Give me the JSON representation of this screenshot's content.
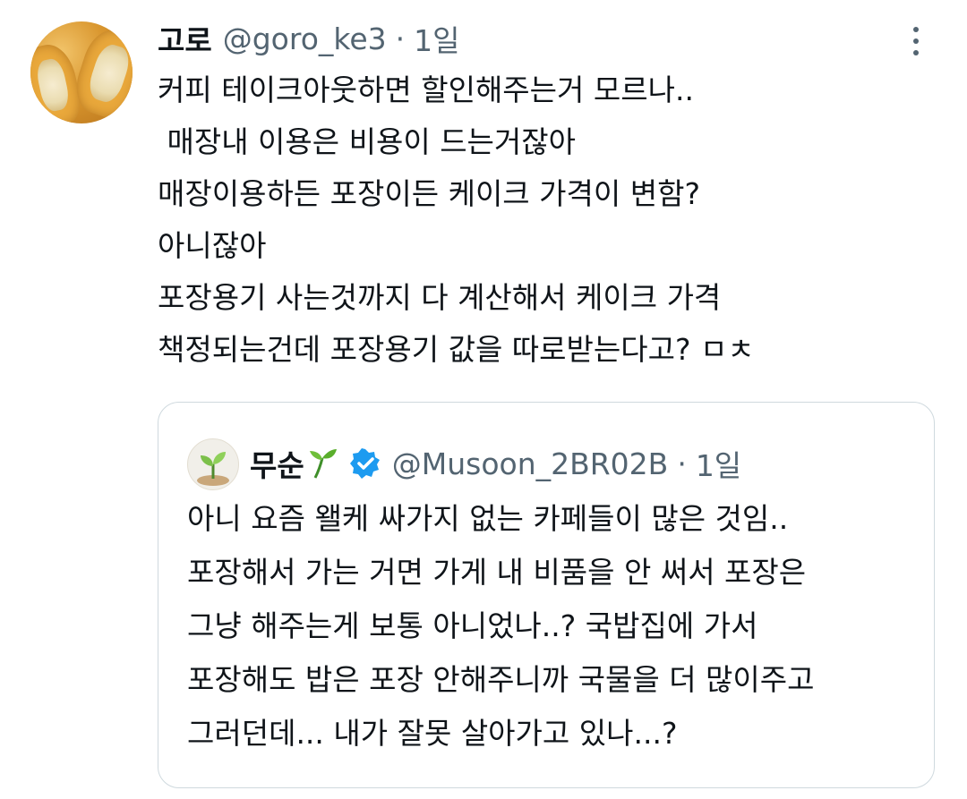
{
  "tweet": {
    "author": {
      "name": "고로",
      "handle": "@goro_ke3"
    },
    "separator": "·",
    "time": "1일",
    "more_icon": "more-vertical-icon",
    "lines": [
      "커피 테이크아웃하면 할인해주는거 모르나..",
      " 매장내 이용은 비용이 드는거잖아",
      "매장이용하든 포장이든 케이크 가격이 변함?",
      "아니잖아",
      "포장용기 사는것까지 다 계산해서 케이크 가격",
      "책정되는건데 포장용기 값을 따로받는다고? ㅁㅊ"
    ]
  },
  "quoted": {
    "author": {
      "name": "무순",
      "name_emoji_icon": "seedling-icon",
      "verified_icon": "verified-badge-icon",
      "handle": "@Musoon_2BR02B"
    },
    "separator": "·",
    "time": "1일",
    "lines": [
      "아니 요즘 왤케 싸가지 없는 카페들이 많은 것임..",
      "포장해서 가는 거면 가게 내 비품을 안 써서 포장은",
      "그냥 해주는게 보통 아니었나..? 국밥집에 가서",
      "포장해도 밥은 포장 안해주니까 국물을 더 많이주고",
      "그러던데... 내가 잘못 살아가고 있나...?"
    ]
  },
  "colors": {
    "text": "#0f1419",
    "secondary": "#536471",
    "border": "#cfd9de",
    "verified": "#1d9bf0"
  }
}
